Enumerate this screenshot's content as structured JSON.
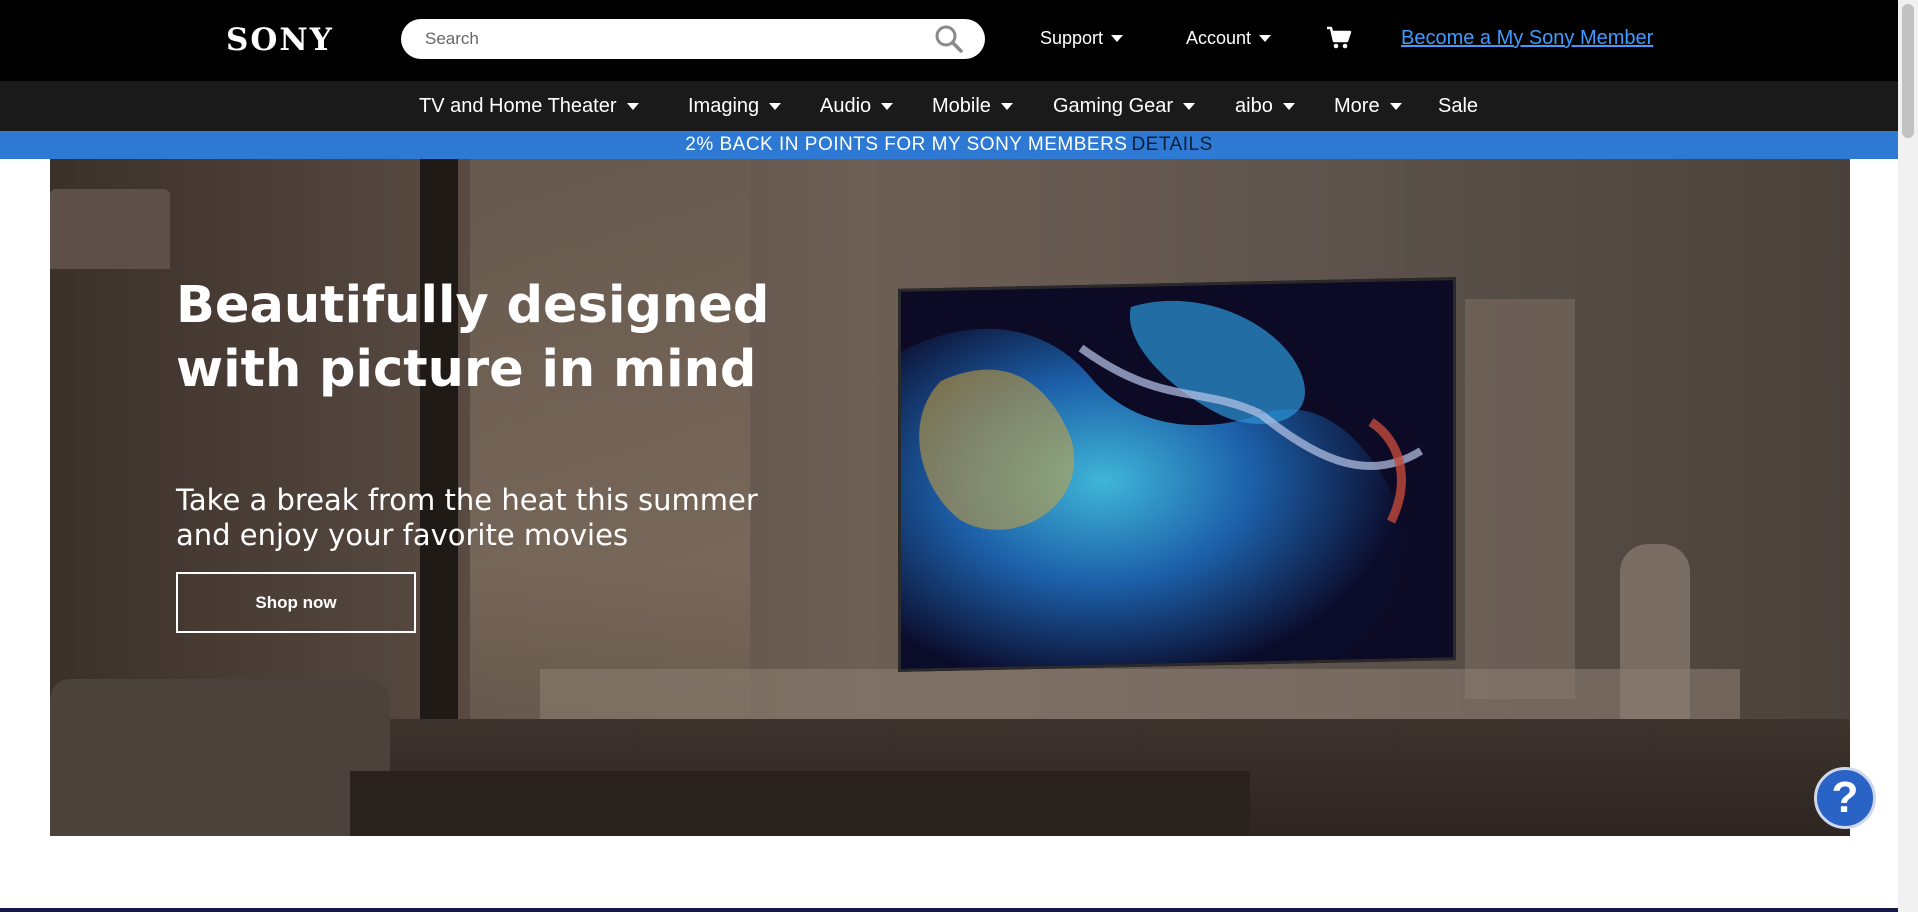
{
  "header": {
    "logo": "SONY",
    "search": {
      "placeholder": "Search"
    },
    "support_label": "Support",
    "account_label": "Account",
    "member_link": "Become a My Sony Member"
  },
  "nav": {
    "items": [
      {
        "label": "TV and Home Theater",
        "has_dropdown": true
      },
      {
        "label": "Imaging",
        "has_dropdown": true
      },
      {
        "label": "Audio",
        "has_dropdown": true
      },
      {
        "label": "Mobile",
        "has_dropdown": true
      },
      {
        "label": "Gaming Gear",
        "has_dropdown": true
      },
      {
        "label": "aibo",
        "has_dropdown": true
      },
      {
        "label": "More",
        "has_dropdown": true
      },
      {
        "label": "Sale",
        "has_dropdown": false
      }
    ]
  },
  "promo": {
    "text": "2% BACK IN POINTS FOR MY SONY MEMBERS",
    "link": "DETAILS",
    "background": "#2d79d3"
  },
  "hero": {
    "headline": "Beautifully designed with picture in mind",
    "subheadline": "Take a break from the heat this summer and enjoy your favorite movies",
    "cta_label": "Shop now"
  },
  "help": {
    "label": "?"
  },
  "icons": {
    "search": "search-icon",
    "cart": "cart-icon",
    "caret": "chevron-down-icon",
    "help": "help-icon"
  },
  "colors": {
    "header_bg": "#000000",
    "nav_bg": "#1a1a1a",
    "link": "#3f9bff",
    "help_button": "#2a63c6"
  }
}
